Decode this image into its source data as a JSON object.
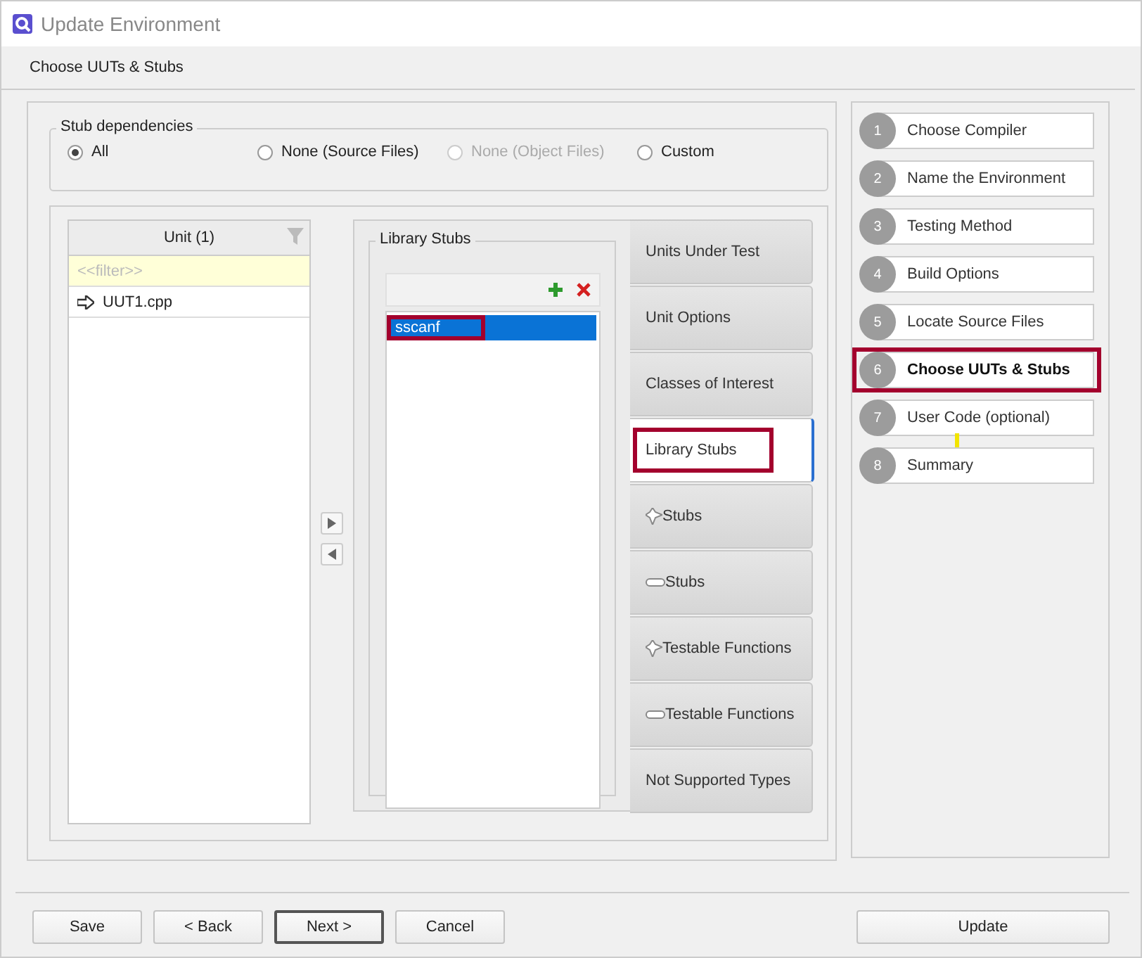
{
  "window": {
    "title": "Update Environment"
  },
  "page_heading": "Choose UUTs & Stubs",
  "stub_dependencies": {
    "label": "Stub dependencies",
    "options": [
      {
        "label": "All",
        "selected": true,
        "disabled": false
      },
      {
        "label": "None (Source Files)",
        "selected": false,
        "disabled": false
      },
      {
        "label": "None (Object Files)",
        "selected": false,
        "disabled": true
      },
      {
        "label": "Custom",
        "selected": false,
        "disabled": false
      }
    ]
  },
  "unit_list": {
    "header": "Unit (1)",
    "filter": {
      "placeholder": "<<filter>>"
    },
    "items": [
      {
        "label": "UUT1.cpp"
      }
    ]
  },
  "library_stubs": {
    "title": "Library Stubs",
    "items": [
      {
        "label": "sscanf",
        "selected": true,
        "highlighted": true
      }
    ]
  },
  "tabs": [
    {
      "label": "Units Under Test",
      "kind": "plain",
      "selected": false,
      "highlighted": false
    },
    {
      "label": "Unit Options",
      "kind": "plain",
      "selected": false,
      "highlighted": false
    },
    {
      "label": "Classes of Interest",
      "kind": "plain",
      "selected": false,
      "highlighted": false
    },
    {
      "label": "Library Stubs",
      "kind": "plain",
      "selected": true,
      "highlighted": true
    },
    {
      "label": "Stubs",
      "kind": "add",
      "selected": false,
      "highlighted": false
    },
    {
      "label": "Stubs",
      "kind": "remove",
      "selected": false,
      "highlighted": false
    },
    {
      "label": "Testable Functions",
      "kind": "add",
      "selected": false,
      "highlighted": false
    },
    {
      "label": "Testable Functions",
      "kind": "remove",
      "selected": false,
      "highlighted": false
    },
    {
      "label": "Not Supported Types",
      "kind": "plain",
      "selected": false,
      "highlighted": false
    }
  ],
  "steps": [
    {
      "number": "1",
      "label": "Choose Compiler",
      "selected": false,
      "highlighted": false,
      "marked": false
    },
    {
      "number": "2",
      "label": "Name the Environment",
      "selected": false,
      "highlighted": false,
      "marked": false
    },
    {
      "number": "3",
      "label": "Testing Method",
      "selected": false,
      "highlighted": false,
      "marked": false
    },
    {
      "number": "4",
      "label": "Build Options",
      "selected": false,
      "highlighted": false,
      "marked": false
    },
    {
      "number": "5",
      "label": "Locate Source Files",
      "selected": false,
      "highlighted": false,
      "marked": false
    },
    {
      "number": "6",
      "label": "Choose UUTs & Stubs",
      "selected": true,
      "highlighted": true,
      "marked": false
    },
    {
      "number": "7",
      "label": "User Code (optional)",
      "selected": false,
      "highlighted": false,
      "marked": true
    },
    {
      "number": "8",
      "label": "Summary",
      "selected": false,
      "highlighted": false,
      "marked": false
    }
  ],
  "buttons": [
    {
      "label": "Save",
      "default": false
    },
    {
      "label": "< Back",
      "default": false
    },
    {
      "label": "Next >",
      "default": true
    },
    {
      "label": "Cancel",
      "default": false
    },
    {
      "label": "Update",
      "default": false
    }
  ]
}
